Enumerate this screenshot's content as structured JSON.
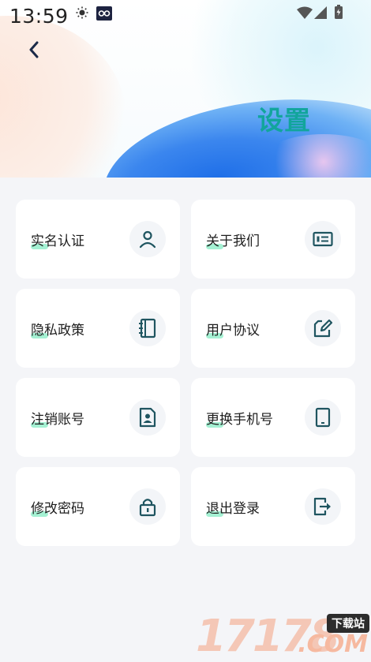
{
  "status_bar": {
    "time": "13:59"
  },
  "header": {
    "title": "设置"
  },
  "menu": [
    {
      "label": "实名认证",
      "icon": "user-icon"
    },
    {
      "label": "关于我们",
      "icon": "id-card-icon"
    },
    {
      "label": "隐私政策",
      "icon": "notebook-icon"
    },
    {
      "label": "用户协议",
      "icon": "edit-document-icon"
    },
    {
      "label": "注销账号",
      "icon": "contact-card-icon"
    },
    {
      "label": "更换手机号",
      "icon": "phone-icon"
    },
    {
      "label": "修改密码",
      "icon": "lock-icon"
    },
    {
      "label": "退出登录",
      "icon": "logout-icon"
    }
  ],
  "watermark": {
    "numbers": "17178",
    "tag": "下载站",
    "domain": ".COM"
  },
  "colors": {
    "title": "#12a59c",
    "icon": "#1f5560",
    "highlight": "#86ecc4",
    "background": "#f4f5f8"
  }
}
